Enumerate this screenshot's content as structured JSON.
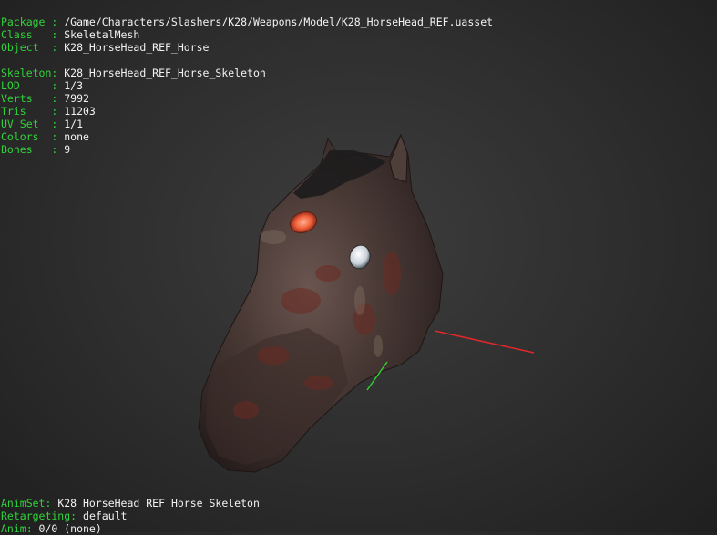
{
  "colors": {
    "label": "#30d23a",
    "value": "#f2f2f2",
    "axis_x": "#e0282a",
    "axis_y": "#2fd02f",
    "axis_z": "#2233dd",
    "background": "#2d2d2d"
  },
  "info": {
    "package": {
      "label": "Package :",
      "value": " /Game/Characters/Slashers/K28/Weapons/Model/K28_HorseHead_REF.uasset"
    },
    "class": {
      "label": "Class   :",
      "value": " SkeletalMesh"
    },
    "object": {
      "label": "Object  :",
      "value": " K28_HorseHead_REF_Horse"
    },
    "skeleton": {
      "label": "Skeleton:",
      "value": " K28_HorseHead_REF_Horse_Skeleton"
    },
    "lod": {
      "label": "LOD     :",
      "value": " 1/3"
    },
    "verts": {
      "label": "Verts   :",
      "value": " 7992"
    },
    "tris": {
      "label": "Tris    :",
      "value": " 11203"
    },
    "uvset": {
      "label": "UV Set  :",
      "value": " 1/1"
    },
    "colors": {
      "label": "Colors  :",
      "value": " none"
    },
    "bones": {
      "label": "Bones   :",
      "value": " 9"
    }
  },
  "anim": {
    "animset": {
      "label": "AnimSet:",
      "value": " K28_HorseHead_REF_Horse_Skeleton"
    },
    "retargeting": {
      "label": "Retargeting:",
      "value": " default"
    },
    "anim": {
      "label": "Anim:",
      "value": " 0/0 (none)"
    }
  },
  "model": {
    "icon": "horse-head-model"
  }
}
